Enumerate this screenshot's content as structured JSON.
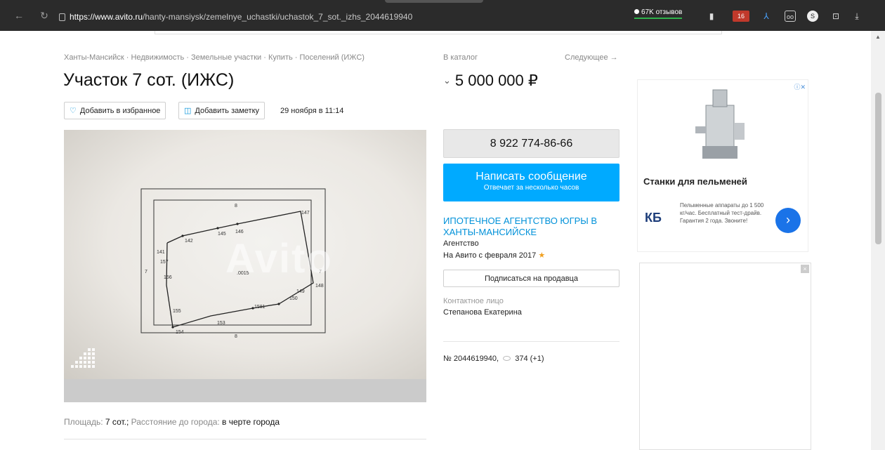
{
  "browser": {
    "url_host": "https://www.avito.ru",
    "url_path": "/hanty-mansiysk/zemelnye_uchastki/uchastok_7_sot._izhs_2044619940",
    "reviews_badge": "67K отзывов",
    "ext_badge": "16"
  },
  "breadcrumb": "Ханты-Мансийск · Недвижимость · Земельные участки · Купить · Поселений (ИЖС)",
  "title": "Участок 7 сот. (ИЖС)",
  "actions": {
    "favorite": "Добавить в избранное",
    "note": "Добавить заметку",
    "date": "29 ноября в 11:14"
  },
  "photo": {
    "watermark": "Avito",
    "labels": [
      "8",
      "147",
      "142",
      "145",
      "146",
      "141",
      "157",
      "7",
      "156",
      ".0015",
      "7",
      "148",
      "149",
      "150",
      "155",
      "153",
      "1581",
      "154",
      "8"
    ]
  },
  "params": {
    "area_label": "Площадь:",
    "area_value": "7 сот.;",
    "distance_label": "Расстояние до города:",
    "distance_value": "в черте города"
  },
  "nav": {
    "catalog": "В каталог",
    "next": "Следующее →"
  },
  "price": "5 000 000 ₽",
  "phone": "8 922 774-86-66",
  "message_btn": {
    "main": "Написать сообщение",
    "sub": "Отвечает за несколько часов"
  },
  "seller": {
    "name": "ИПОТЕЧНОЕ АГЕНТСТВО ЮГРЫ В ХАНТЫ-МАНСИЙСКЕ",
    "type": "Агентство",
    "since": "На Авито с февраля 2017"
  },
  "subscribe_btn": "Подписаться на продавца",
  "contact": {
    "label": "Контактное лицо",
    "name": "Степанова Екатерина"
  },
  "ad_meta": {
    "id": "№ 2044619940,",
    "views": "374 (+1)"
  },
  "ad": {
    "title": "Станки для пельменей",
    "logo": "КБ",
    "text": "Пельменные аппараты до 1 500 кг/час. Бесплатный тест-драйв. Гарантия 2 года. Звоните!"
  }
}
